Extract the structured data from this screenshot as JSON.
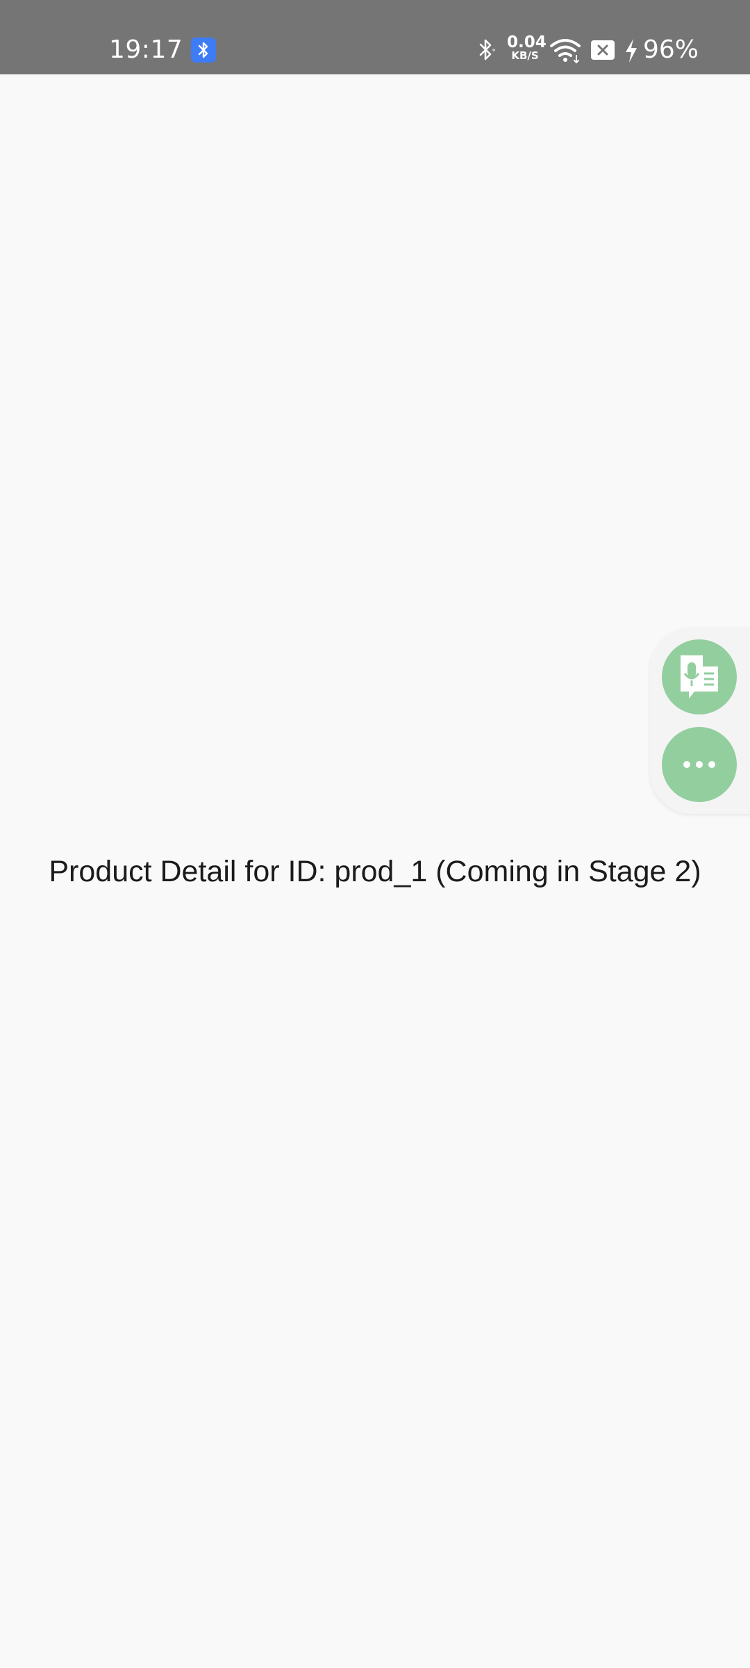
{
  "status_bar": {
    "time": "19:17",
    "net_speed_value": "0.04",
    "net_speed_unit": "KB/S",
    "battery": "96%",
    "icons": [
      "bluetooth-notification-icon",
      "bluetooth-icon",
      "wifi-icon",
      "sim-error-icon",
      "charging-icon"
    ]
  },
  "main": {
    "message": "Product Detail for ID: prod_1 (Coming in Stage 2)"
  },
  "floating_panel": {
    "buttons": [
      {
        "name": "voice-to-text",
        "icon": "voice-transcribe-icon"
      },
      {
        "name": "more",
        "icon": "more-horizontal-icon"
      }
    ],
    "accent": "#93ce9f"
  },
  "colors": {
    "status_bar_bg": "#757575",
    "page_bg": "#f9f9f9",
    "bluetooth_badge": "#3d7cf5"
  }
}
